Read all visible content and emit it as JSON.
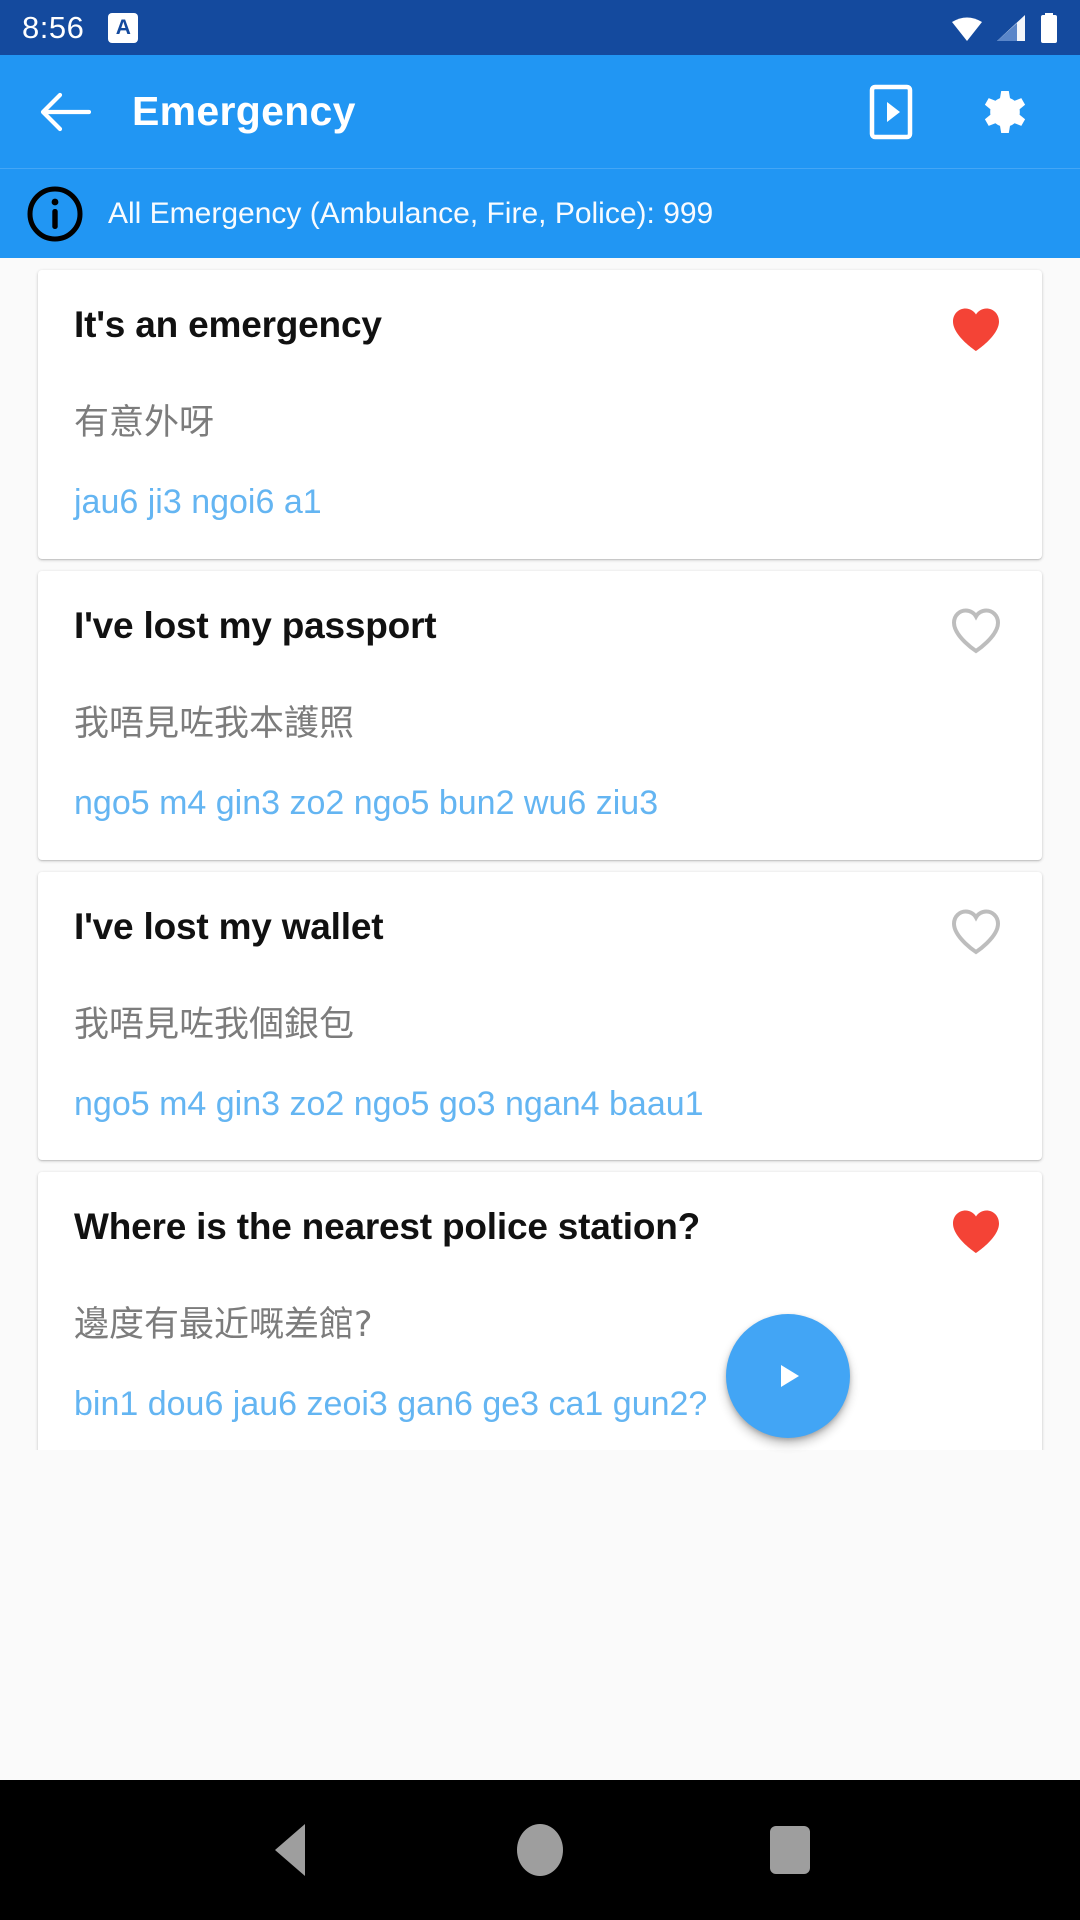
{
  "statusbar": {
    "time": "8:56",
    "notification_icon_letter": "A",
    "icons": [
      "wifi-icon",
      "signal-icon",
      "battery-icon"
    ]
  },
  "appbar": {
    "back_icon": "back-arrow-icon",
    "title": "Emergency",
    "actions": [
      {
        "icon": "phone-play-icon"
      },
      {
        "icon": "gear-icon"
      }
    ]
  },
  "infobar": {
    "icon": "info-circle-icon",
    "text": "All Emergency (Ambulance, Fire, Police): 999"
  },
  "cards": [
    {
      "title": "It's an emergency",
      "chinese": "有意外呀",
      "romanization": "jau6 ji3 ngoi6 a1",
      "favorite": true,
      "heart_icon": "heart-filled-icon"
    },
    {
      "title": "I've lost my passport",
      "chinese": "我唔見咗我本護照",
      "romanization": "ngo5 m4 gin3 zo2 ngo5 bun2 wu6 ziu3",
      "favorite": false,
      "heart_icon": "heart-outline-icon"
    },
    {
      "title": "I've lost my wallet",
      "chinese": "我唔見咗我個銀包",
      "romanization": "ngo5 m4 gin3 zo2 ngo5 go3 ngan4 baau1",
      "favorite": false,
      "heart_icon": "heart-outline-icon"
    },
    {
      "title": "Where is the nearest police station?",
      "chinese": "邊度有最近嘅差館?",
      "romanization": "bin1 dou6 jau6 zeoi3 gan6 ge3 ca1 gun2?",
      "favorite": true,
      "heart_icon": "heart-filled-icon"
    }
  ],
  "fab": {
    "icon": "play-icon"
  },
  "navbar": {
    "back": "nav-back-icon",
    "home": "nav-home-icon",
    "recents": "nav-recents-icon"
  },
  "colors": {
    "status_bar": "#144a9e",
    "app_bar": "#2196f3",
    "accent": "#42a5f5",
    "favorite_active": "#f44336",
    "favorite_inactive": "#bdbdbd",
    "romanization": "#64b5f2",
    "chinese": "#7c7c7c"
  }
}
